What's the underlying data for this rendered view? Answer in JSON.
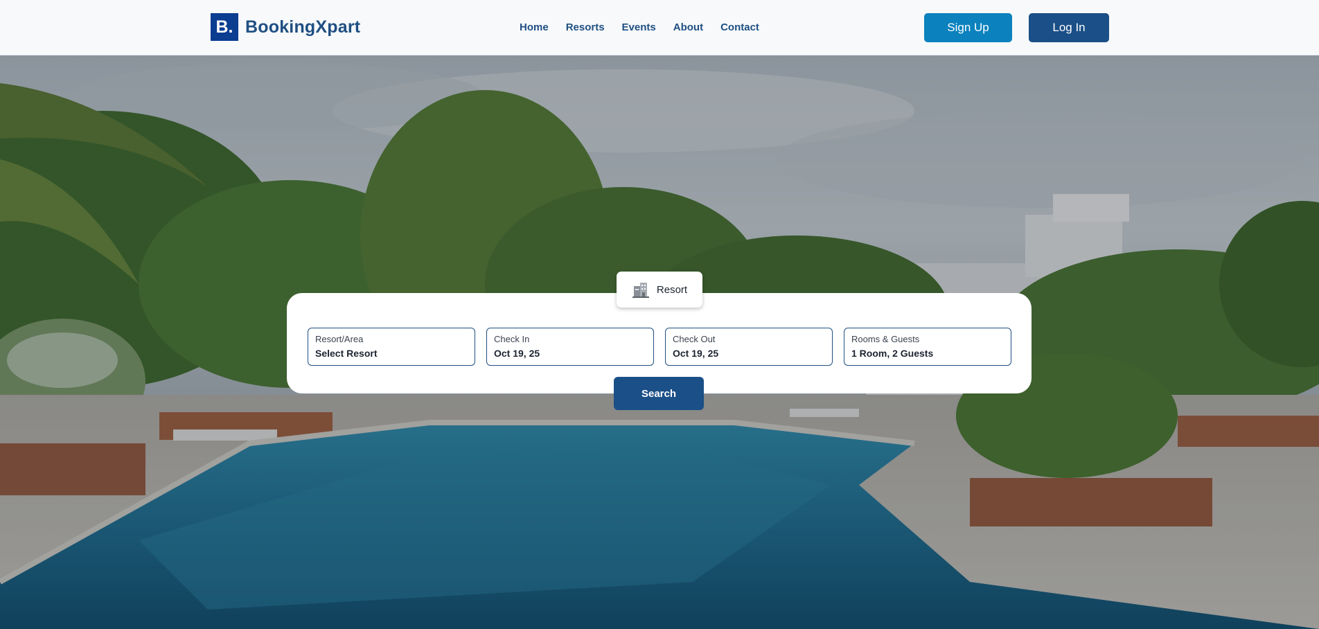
{
  "brand": {
    "mark": "B.",
    "name": "BookingXpart"
  },
  "nav": {
    "items": [
      {
        "label": "Home"
      },
      {
        "label": "Resorts"
      },
      {
        "label": "Events"
      },
      {
        "label": "About"
      },
      {
        "label": "Contact"
      }
    ]
  },
  "auth": {
    "signup_label": "Sign Up",
    "login_label": "Log In"
  },
  "search": {
    "active_tab": {
      "label": "Resort",
      "icon": "hotel-building-icon"
    },
    "fields": [
      {
        "label": "Resort/Area",
        "value": "Select Resort"
      },
      {
        "label": "Check In",
        "value": "Oct 19, 25"
      },
      {
        "label": "Check Out",
        "value": "Oct 19, 25"
      },
      {
        "label": "Rooms & Guests",
        "value": "1 Room, 2 Guests"
      }
    ],
    "button_label": "Search"
  },
  "colors": {
    "brand_blue": "#0b3d91",
    "primary_dark": "#1b4f87",
    "signup_blue": "#0b82be",
    "nav_text": "#1f4f82"
  }
}
